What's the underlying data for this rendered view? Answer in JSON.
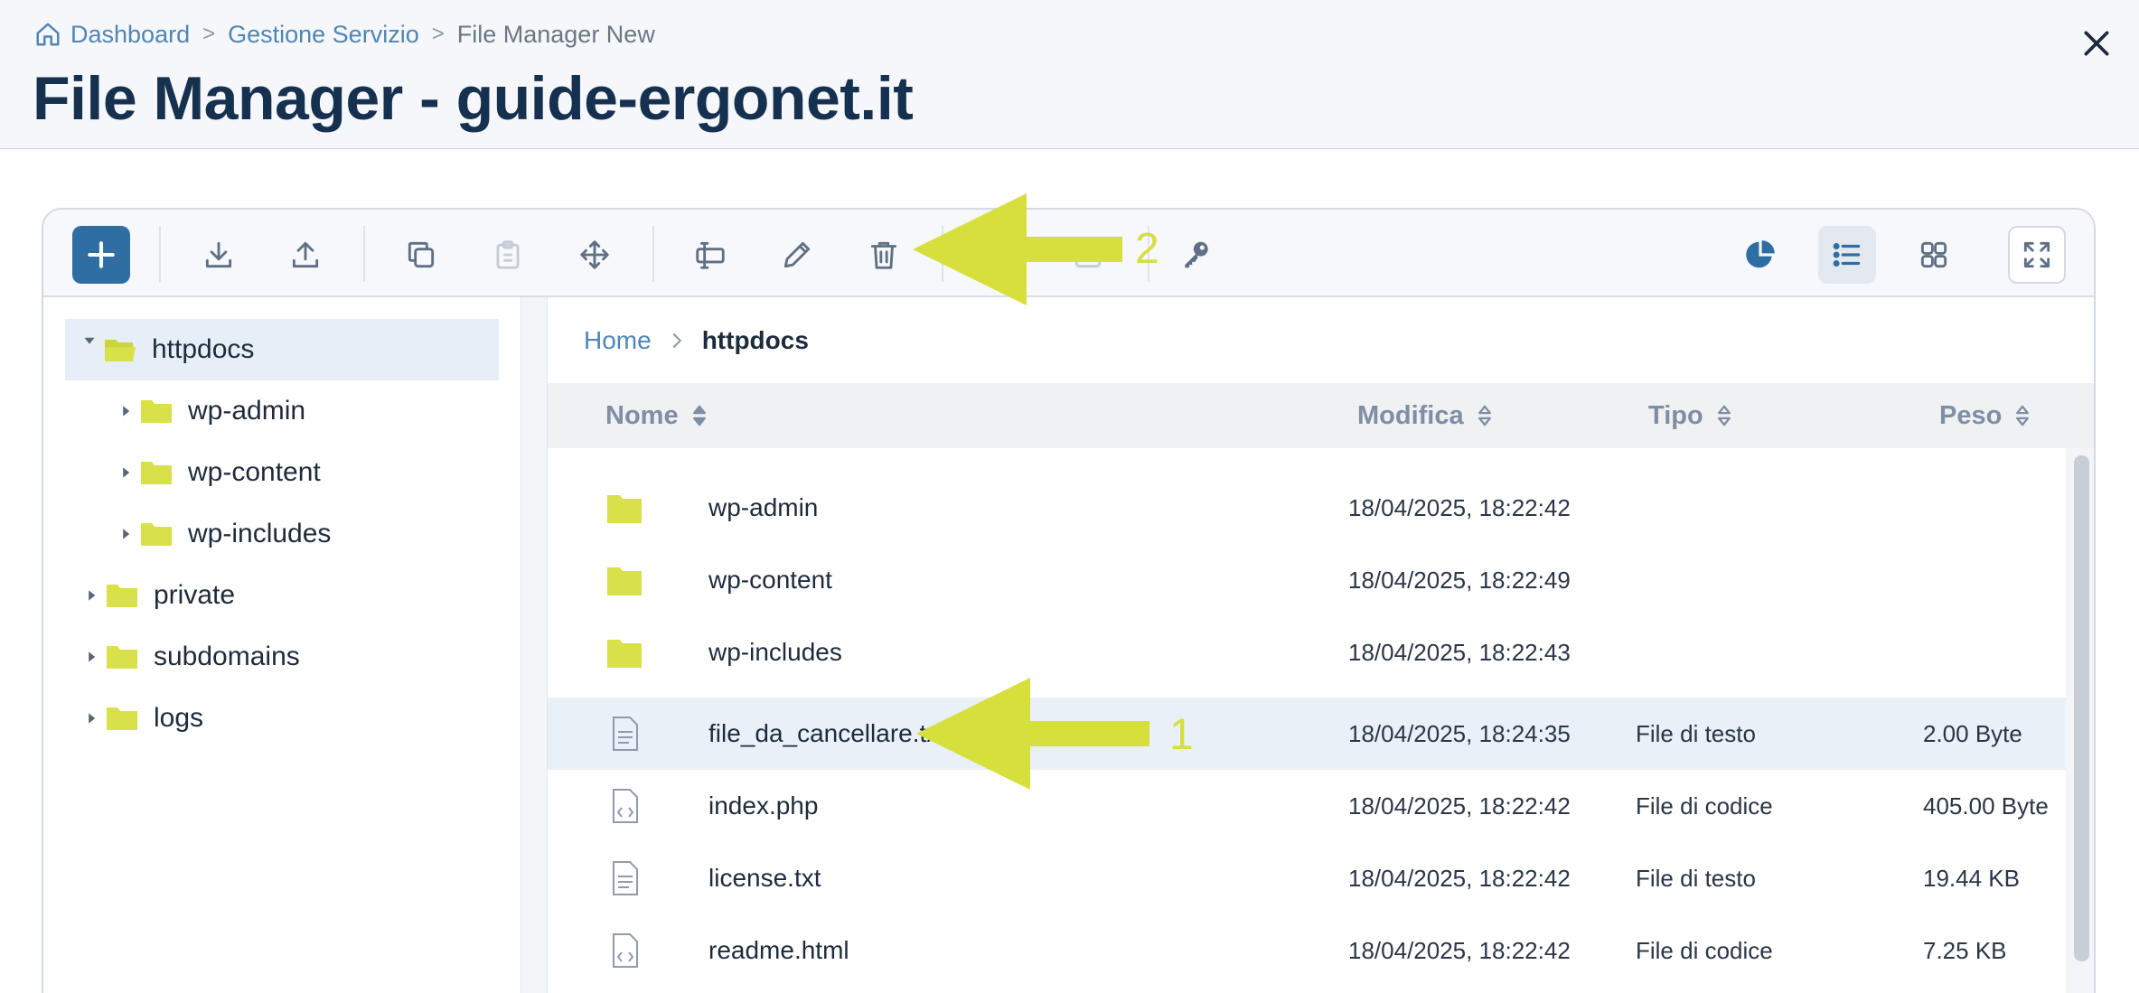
{
  "breadcrumb": {
    "home_icon": "home-icon",
    "items": [
      "Dashboard",
      "Gestione Servizio",
      "File Manager New"
    ],
    "separator": ">"
  },
  "page_title": "File Manager - guide-ergonet.it",
  "close_icon": "close-icon",
  "toolbar": {
    "buttons": [
      "add-icon",
      "download-icon",
      "upload-icon",
      "copy-icon",
      "paste-icon",
      "move-icon",
      "rename-icon",
      "edit-icon",
      "delete-icon",
      "compress-icon",
      "permissions-key-icon",
      "disk-usage-icon",
      "list-view-icon",
      "grid-view-icon",
      "fullscreen-icon"
    ]
  },
  "tree": {
    "items": [
      {
        "label": "httpdocs",
        "expanded": true,
        "selected": true
      },
      {
        "label": "wp-admin"
      },
      {
        "label": "wp-content"
      },
      {
        "label": "wp-includes"
      },
      {
        "label": "private"
      },
      {
        "label": "subdomains"
      },
      {
        "label": "logs"
      }
    ]
  },
  "path": {
    "home": "Home",
    "current": "httpdocs"
  },
  "columns": {
    "name": "Nome",
    "modified": "Modifica",
    "type": "Tipo",
    "size": "Peso"
  },
  "files": [
    {
      "name": "wp-admin",
      "modified": "18/04/2025, 18:22:42",
      "type": "",
      "size": "",
      "icon": "folder-icon"
    },
    {
      "name": "wp-content",
      "modified": "18/04/2025, 18:22:49",
      "type": "",
      "size": "",
      "icon": "folder-icon"
    },
    {
      "name": "wp-includes",
      "modified": "18/04/2025, 18:22:43",
      "type": "",
      "size": "",
      "icon": "folder-icon"
    },
    {
      "name": "file_da_cancellare.txt",
      "modified": "18/04/2025, 18:24:35",
      "type": "File di testo",
      "size": "2.00 Byte",
      "icon": "text-file-icon",
      "highlighted": true
    },
    {
      "name": "index.php",
      "modified": "18/04/2025, 18:22:42",
      "type": "File di codice",
      "size": "405.00 Byte",
      "icon": "code-file-icon"
    },
    {
      "name": "license.txt",
      "modified": "18/04/2025, 18:22:42",
      "type": "File di testo",
      "size": "19.44 KB",
      "icon": "text-file-icon"
    },
    {
      "name": "readme.html",
      "modified": "18/04/2025, 18:22:42",
      "type": "File di codice",
      "size": "7.25 KB",
      "icon": "code-file-icon"
    }
  ],
  "annotations": {
    "arrow_1": "1",
    "arrow_2": "2"
  },
  "colors": {
    "accent": "#2f6ea3",
    "folder": "#d8e04a",
    "annotation": "#d6df3c",
    "title": "#16314f",
    "link": "#4f86b5"
  }
}
